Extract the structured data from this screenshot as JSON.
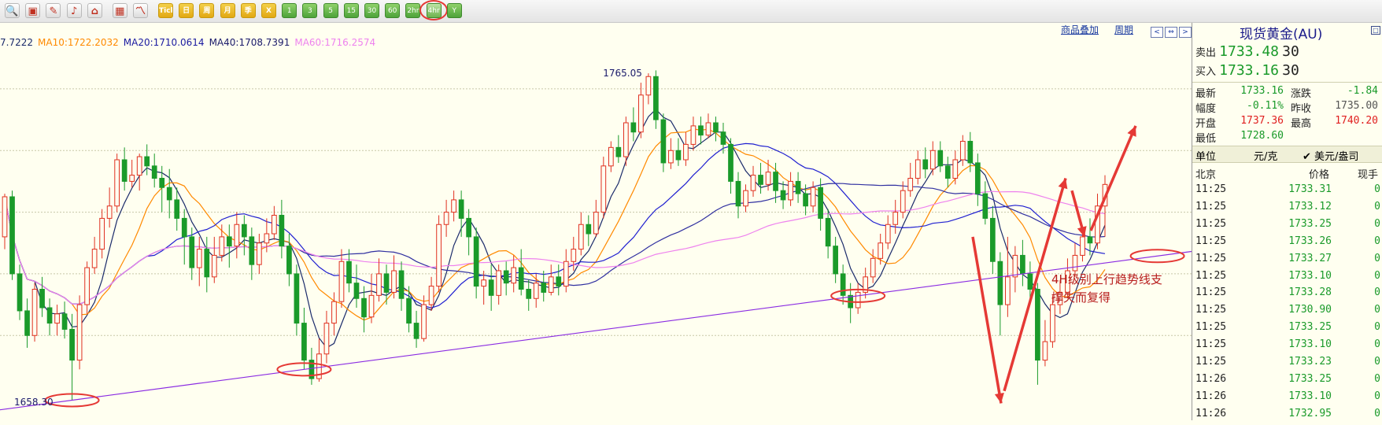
{
  "colors": {
    "up": "#e03020",
    "down": "#1a9a2a",
    "ma5": "#1a2a6a",
    "ma10": "#ff8a00",
    "ma20": "#2020d0",
    "ma40": "#3030a0",
    "ma60": "#ee82ee",
    "trendline": "#8a2be2",
    "annotation": "#e53935",
    "annotation_text": "#b71c1c",
    "panel_title": "#1a1a8a",
    "price_green": "#1a9a2a",
    "price_red": "#e02020"
  },
  "toolbar": {
    "buttons": [
      {
        "name": "zoom-icon",
        "label": "",
        "glyph": "🔍",
        "kind": "icon"
      },
      {
        "name": "layers-icon",
        "label": "",
        "glyph": "▣",
        "kind": "icon"
      },
      {
        "name": "pen-icon",
        "label": "",
        "glyph": "✎",
        "kind": "icon"
      },
      {
        "name": "bell-icon",
        "label": "",
        "glyph": "♪",
        "kind": "icon"
      },
      {
        "name": "home-icon",
        "label": "",
        "glyph": "⌂",
        "kind": "icon"
      },
      {
        "name": "table-icon",
        "label": "",
        "glyph": "▦",
        "kind": "icon"
      },
      {
        "name": "line-chart-icon",
        "label": "",
        "glyph": "〽",
        "kind": "icon"
      },
      {
        "name": "period-tick",
        "label": "Tick",
        "kind": "period"
      },
      {
        "name": "period-day",
        "label": "日",
        "kind": "period"
      },
      {
        "name": "period-week",
        "label": "周",
        "kind": "period"
      },
      {
        "name": "period-month",
        "label": "月",
        "kind": "period"
      },
      {
        "name": "period-quarter",
        "label": "季",
        "kind": "period"
      },
      {
        "name": "period-year",
        "label": "X",
        "kind": "period"
      },
      {
        "name": "period-1m",
        "label": "1",
        "kind": "num"
      },
      {
        "name": "period-3m",
        "label": "3",
        "kind": "num"
      },
      {
        "name": "period-5m",
        "label": "5",
        "kind": "num"
      },
      {
        "name": "period-15m",
        "label": "15",
        "kind": "num"
      },
      {
        "name": "period-30m",
        "label": "30",
        "kind": "num"
      },
      {
        "name": "period-60m",
        "label": "60",
        "kind": "num"
      },
      {
        "name": "period-2h",
        "label": "2hr",
        "kind": "num"
      },
      {
        "name": "period-4h",
        "label": "4hr",
        "kind": "num",
        "selected": true
      },
      {
        "name": "period-custom",
        "label": "Y",
        "kind": "num"
      }
    ]
  },
  "chart_header": {
    "ma_values": [
      {
        "label": "7.7222",
        "color": "#1a2a6a"
      },
      {
        "label": "MA10:1722.2032",
        "color": "#ff8a00"
      },
      {
        "label": "MA20:1710.0614",
        "color": "#1a1aa0"
      },
      {
        "label": "MA40:1708.7391",
        "color": "#1a1a6a"
      },
      {
        "label": "MA60:1716.2574",
        "color": "#ee82ee"
      }
    ],
    "overlay_link": "商品叠加",
    "period_link": "周期"
  },
  "chart_data": {
    "type": "candlestick",
    "instrument": "现货黄金(AU)",
    "period": "4hr",
    "ylim": [
      1653,
      1773
    ],
    "high_label": "1765.05",
    "low_label": "1658.30",
    "candles": [
      [
        1712,
        1725,
        1726,
        1708
      ],
      [
        1725,
        1700,
        1727,
        1698
      ],
      [
        1700,
        1688,
        1703,
        1685
      ],
      [
        1688,
        1680,
        1692,
        1676
      ],
      [
        1680,
        1695,
        1697,
        1678
      ],
      [
        1695,
        1689,
        1699,
        1686
      ],
      [
        1689,
        1684,
        1692,
        1680
      ],
      [
        1684,
        1687,
        1690,
        1680
      ],
      [
        1687,
        1682,
        1691,
        1679
      ],
      [
        1682,
        1672,
        1687,
        1659
      ],
      [
        1672,
        1690,
        1693,
        1669
      ],
      [
        1690,
        1702,
        1704,
        1687
      ],
      [
        1702,
        1708,
        1712,
        1700
      ],
      [
        1708,
        1718,
        1721,
        1705
      ],
      [
        1718,
        1722,
        1728,
        1715
      ],
      [
        1722,
        1737,
        1739,
        1720
      ],
      [
        1737,
        1730,
        1741,
        1727
      ],
      [
        1730,
        1732,
        1737,
        1728
      ],
      [
        1732,
        1738,
        1739,
        1727
      ],
      [
        1738,
        1735,
        1742,
        1732
      ],
      [
        1735,
        1731,
        1739,
        1728
      ],
      [
        1731,
        1728,
        1735,
        1720
      ],
      [
        1728,
        1724,
        1734,
        1718
      ],
      [
        1724,
        1718,
        1728,
        1714
      ],
      [
        1718,
        1712,
        1721,
        1703
      ],
      [
        1712,
        1702,
        1715,
        1698
      ],
      [
        1702,
        1708,
        1712,
        1696
      ],
      [
        1708,
        1699,
        1712,
        1694
      ],
      [
        1699,
        1706,
        1712,
        1697
      ],
      [
        1706,
        1712,
        1716,
        1704
      ],
      [
        1712,
        1709,
        1716,
        1702
      ],
      [
        1709,
        1716,
        1720,
        1705
      ],
      [
        1716,
        1712,
        1719,
        1706
      ],
      [
        1712,
        1703,
        1715,
        1698
      ],
      [
        1703,
        1710,
        1713,
        1700
      ],
      [
        1710,
        1713,
        1718,
        1707
      ],
      [
        1713,
        1719,
        1722,
        1711
      ],
      [
        1719,
        1709,
        1724,
        1705
      ],
      [
        1709,
        1700,
        1713,
        1696
      ],
      [
        1700,
        1684,
        1703,
        1680
      ],
      [
        1684,
        1672,
        1689,
        1669
      ],
      [
        1672,
        1666,
        1676,
        1664
      ],
      [
        1666,
        1674,
        1679,
        1665
      ],
      [
        1674,
        1684,
        1688,
        1671
      ],
      [
        1684,
        1691,
        1694,
        1680
      ],
      [
        1691,
        1704,
        1708,
        1689
      ],
      [
        1704,
        1697,
        1708,
        1694
      ],
      [
        1697,
        1692,
        1703,
        1689
      ],
      [
        1692,
        1686,
        1696,
        1681
      ],
      [
        1686,
        1693,
        1700,
        1684
      ],
      [
        1693,
        1700,
        1705,
        1691
      ],
      [
        1700,
        1694,
        1703,
        1690
      ],
      [
        1694,
        1701,
        1706,
        1692
      ],
      [
        1701,
        1692,
        1704,
        1688
      ],
      [
        1692,
        1684,
        1696,
        1681
      ],
      [
        1684,
        1679,
        1688,
        1676
      ],
      [
        1679,
        1690,
        1693,
        1678
      ],
      [
        1690,
        1696,
        1699,
        1688
      ],
      [
        1696,
        1716,
        1719,
        1694
      ],
      [
        1716,
        1720,
        1724,
        1712
      ],
      [
        1720,
        1724,
        1727,
        1717
      ],
      [
        1724,
        1718,
        1727,
        1712
      ],
      [
        1718,
        1712,
        1721,
        1706
      ],
      [
        1712,
        1696,
        1715,
        1692
      ],
      [
        1696,
        1698,
        1701,
        1690
      ],
      [
        1698,
        1693,
        1703,
        1688
      ],
      [
        1693,
        1701,
        1703,
        1690
      ],
      [
        1701,
        1697,
        1704,
        1693
      ],
      [
        1697,
        1702,
        1706,
        1694
      ],
      [
        1702,
        1695,
        1708,
        1693
      ],
      [
        1695,
        1692,
        1698,
        1688
      ],
      [
        1692,
        1697,
        1700,
        1689
      ],
      [
        1697,
        1694,
        1701,
        1691
      ],
      [
        1694,
        1699,
        1703,
        1693
      ],
      [
        1699,
        1696,
        1703,
        1693
      ],
      [
        1696,
        1704,
        1708,
        1694
      ],
      [
        1704,
        1708,
        1712,
        1701
      ],
      [
        1708,
        1716,
        1720,
        1706
      ],
      [
        1716,
        1713,
        1719,
        1709
      ],
      [
        1713,
        1720,
        1724,
        1712
      ],
      [
        1720,
        1735,
        1738,
        1718
      ],
      [
        1735,
        1741,
        1743,
        1733
      ],
      [
        1741,
        1738,
        1745,
        1736
      ],
      [
        1738,
        1749,
        1751,
        1735
      ],
      [
        1749,
        1746,
        1754,
        1743
      ],
      [
        1746,
        1758,
        1762,
        1744
      ],
      [
        1758,
        1764,
        1765.05,
        1755
      ],
      [
        1764,
        1750,
        1766,
        1747
      ],
      [
        1750,
        1736,
        1752,
        1733
      ],
      [
        1736,
        1740,
        1744,
        1734
      ],
      [
        1740,
        1737,
        1744,
        1735
      ],
      [
        1737,
        1742,
        1746,
        1735
      ],
      [
        1742,
        1748,
        1751,
        1740
      ],
      [
        1748,
        1745,
        1751,
        1742
      ],
      [
        1745,
        1749,
        1752,
        1744
      ],
      [
        1749,
        1746,
        1751,
        1743
      ],
      [
        1746,
        1742,
        1749,
        1739
      ],
      [
        1742,
        1730,
        1744,
        1726
      ],
      [
        1730,
        1722,
        1733,
        1718
      ],
      [
        1722,
        1727,
        1729,
        1720
      ],
      [
        1727,
        1732,
        1735,
        1725
      ],
      [
        1732,
        1729,
        1736,
        1726
      ],
      [
        1729,
        1733,
        1737,
        1727
      ],
      [
        1733,
        1727,
        1736,
        1723
      ],
      [
        1727,
        1724,
        1730,
        1721
      ],
      [
        1724,
        1730,
        1733,
        1722
      ],
      [
        1730,
        1726,
        1733,
        1723
      ],
      [
        1726,
        1722,
        1729,
        1719
      ],
      [
        1722,
        1728,
        1730,
        1720
      ],
      [
        1728,
        1718,
        1731,
        1714
      ],
      [
        1718,
        1709,
        1721,
        1705
      ],
      [
        1709,
        1700,
        1712,
        1697
      ],
      [
        1700,
        1693,
        1703,
        1690
      ],
      [
        1693,
        1689,
        1697,
        1684
      ],
      [
        1689,
        1694,
        1697,
        1687
      ],
      [
        1694,
        1699,
        1702,
        1692
      ],
      [
        1699,
        1705,
        1708,
        1697
      ],
      [
        1705,
        1710,
        1713,
        1703
      ],
      [
        1710,
        1716,
        1719,
        1708
      ],
      [
        1716,
        1720,
        1724,
        1713
      ],
      [
        1720,
        1727,
        1730,
        1718
      ],
      [
        1727,
        1731,
        1736,
        1725
      ],
      [
        1731,
        1737,
        1740,
        1729
      ],
      [
        1737,
        1734,
        1741,
        1731
      ],
      [
        1734,
        1740,
        1743,
        1732
      ],
      [
        1740,
        1735,
        1743,
        1733
      ],
      [
        1735,
        1731,
        1738,
        1728
      ],
      [
        1731,
        1737,
        1740,
        1729
      ],
      [
        1737,
        1743,
        1745,
        1735
      ],
      [
        1743,
        1736,
        1746,
        1733
      ],
      [
        1736,
        1726,
        1739,
        1722
      ],
      [
        1726,
        1718,
        1730,
        1716
      ],
      [
        1718,
        1704,
        1722,
        1700
      ],
      [
        1704,
        1690,
        1707,
        1680
      ],
      [
        1690,
        1699,
        1712,
        1686
      ],
      [
        1699,
        1706,
        1709,
        1694
      ],
      [
        1706,
        1700,
        1711,
        1696
      ],
      [
        1700,
        1695,
        1704,
        1692
      ],
      [
        1695,
        1672,
        1697,
        1664
      ],
      [
        1672,
        1678,
        1685,
        1670
      ],
      [
        1678,
        1690,
        1693,
        1676
      ],
      [
        1690,
        1694,
        1698,
        1687
      ],
      [
        1694,
        1701,
        1705,
        1692
      ],
      [
        1701,
        1706,
        1710,
        1699
      ],
      [
        1706,
        1712,
        1714,
        1704
      ],
      [
        1712,
        1710,
        1718,
        1706
      ],
      [
        1710,
        1722,
        1726,
        1708
      ],
      [
        1722,
        1729,
        1732,
        1712
      ]
    ],
    "annotation": "4H级别上行趋势线支撑失而复得"
  },
  "quote": {
    "title": "现货黄金(AU)",
    "sell_label": "卖出",
    "sell_price": "1733.48",
    "sell_vol": "30",
    "buy_label": "买入",
    "buy_price": "1733.16",
    "buy_vol": "30",
    "latest_label": "最新",
    "latest": "1733.16",
    "change_label": "涨跌",
    "change": "-1.84",
    "pct_label": "幅度",
    "pct": "-0.11%",
    "prev_label": "昨收",
    "prev": "1735.00",
    "open_label": "开盘",
    "open": "1737.36",
    "high_label": "最高",
    "high": "1740.20",
    "low_label": "最低",
    "low": "1728.60",
    "unit_label": "单位",
    "unit": "元/克",
    "unit_usd": "✔ 美元/盎司",
    "tick_headers": {
      "time": "北京",
      "price": "价格",
      "vol": "现手"
    },
    "ticks": [
      {
        "time": "11:25",
        "price": "1733.31",
        "vol": "0"
      },
      {
        "time": "11:25",
        "price": "1733.12",
        "vol": "0"
      },
      {
        "time": "11:25",
        "price": "1733.25",
        "vol": "0"
      },
      {
        "time": "11:25",
        "price": "1733.26",
        "vol": "0"
      },
      {
        "time": "11:25",
        "price": "1733.27",
        "vol": "0"
      },
      {
        "time": "11:25",
        "price": "1733.10",
        "vol": "0"
      },
      {
        "time": "11:25",
        "price": "1733.28",
        "vol": "0"
      },
      {
        "time": "11:25",
        "price": "1730.90",
        "vol": "0"
      },
      {
        "time": "11:25",
        "price": "1733.25",
        "vol": "0"
      },
      {
        "time": "11:25",
        "price": "1733.10",
        "vol": "0"
      },
      {
        "time": "11:25",
        "price": "1733.23",
        "vol": "0"
      },
      {
        "time": "11:26",
        "price": "1733.25",
        "vol": "0"
      },
      {
        "time": "11:26",
        "price": "1733.10",
        "vol": "0"
      },
      {
        "time": "11:26",
        "price": "1732.95",
        "vol": "0"
      }
    ]
  }
}
